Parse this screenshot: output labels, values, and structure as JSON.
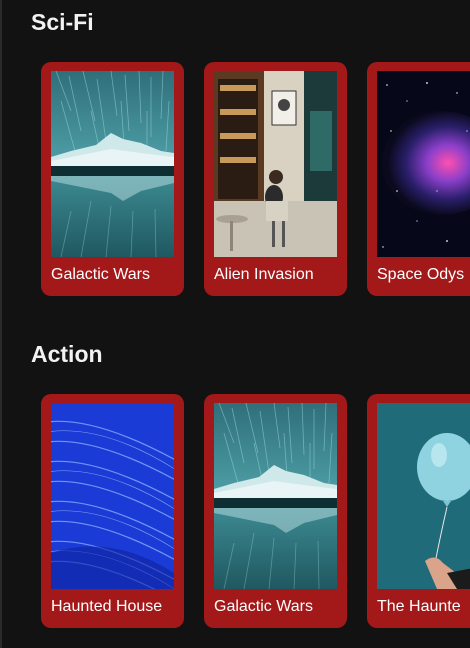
{
  "sections": [
    {
      "title": "Sci-Fi",
      "movies": [
        {
          "title": "Galactic Wars",
          "poster": "star-trail-mountain-lake"
        },
        {
          "title": "Alien Invasion",
          "poster": "cafe-street-person"
        },
        {
          "title": "Space Odys",
          "poster": "nebula-space"
        }
      ]
    },
    {
      "title": "Action",
      "movies": [
        {
          "title": "Haunted House",
          "poster": "blue-light-streaks"
        },
        {
          "title": "Galactic Wars",
          "poster": "star-trail-mountain-lake"
        },
        {
          "title": "The Haunte",
          "poster": "hand-holding-balloon"
        }
      ]
    }
  ],
  "colors": {
    "background": "#121212",
    "card": "#a3191a",
    "text": "#ffffff"
  }
}
